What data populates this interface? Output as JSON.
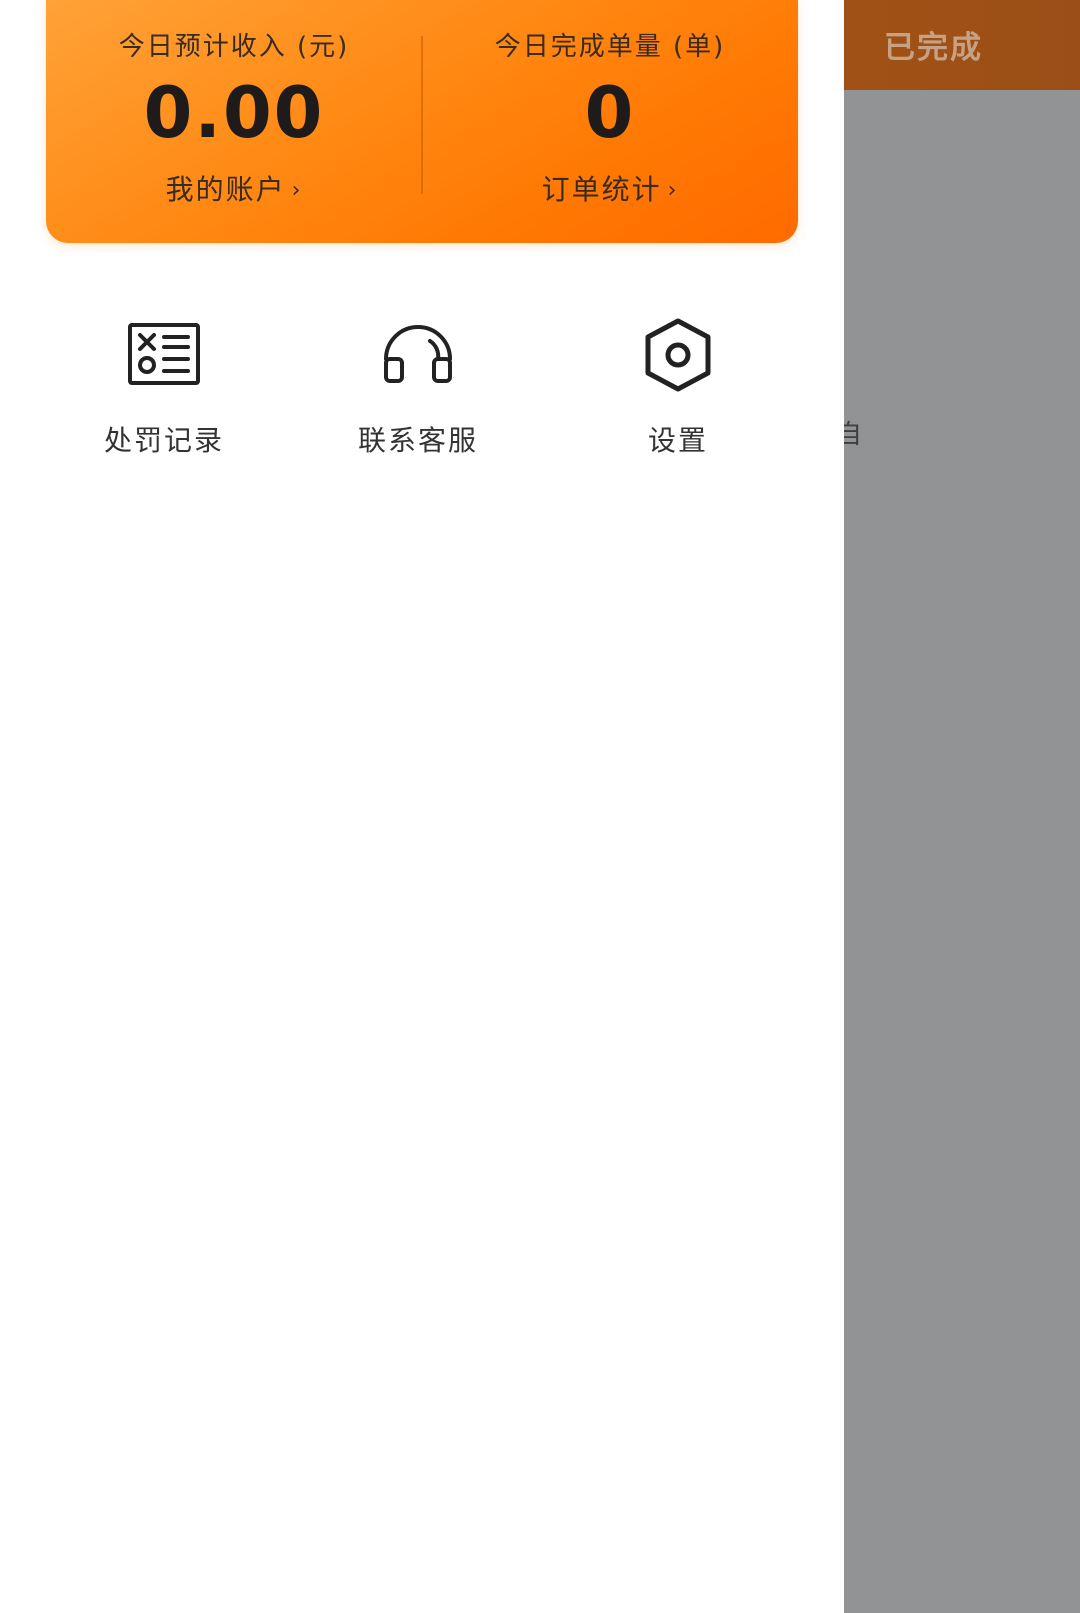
{
  "background": {
    "tab_completed": "已完成",
    "fragment_text": "自"
  },
  "stats": {
    "income_label": "今日预计收入 (元)",
    "income_value": "0.00",
    "account_link": "我的账户",
    "orders_label": "今日完成单量 (单)",
    "orders_value": "0",
    "orders_link": "订单统计",
    "chevron": "›"
  },
  "shortcuts": [
    {
      "label": "处罚记录",
      "icon": "penalty-record-icon"
    },
    {
      "label": "联系客服",
      "icon": "headset-icon"
    },
    {
      "label": "设置",
      "icon": "settings-icon"
    }
  ],
  "colors": {
    "accent": "#ff8200",
    "overlay": "#929395"
  }
}
